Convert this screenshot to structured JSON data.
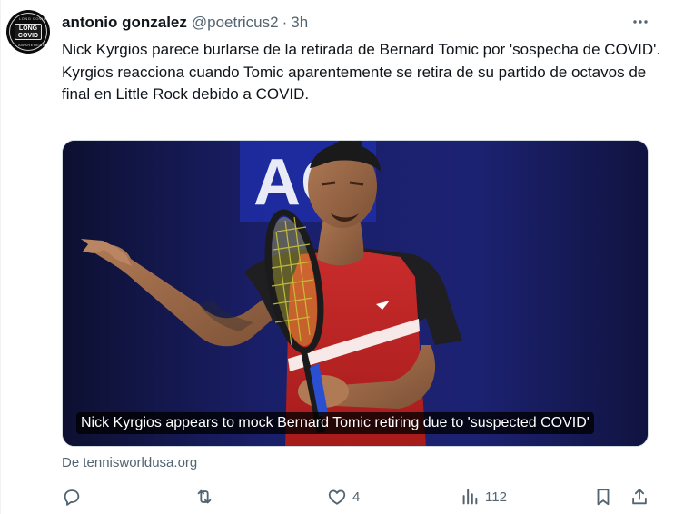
{
  "tweet": {
    "avatar_text": "LONG COVID",
    "avatar_arc_top": "LONG COVID",
    "avatar_arc_bottom": "AWARENESS",
    "display_name": "antonio gonzalez",
    "handle": "@poetricus2",
    "separator": "·",
    "time": "3h",
    "text_lines": [
      "Nick Kyrgios parece burlarse de la retirada de Bernard Tomic por 'sospecha de COVID'.",
      "Kyrgios reacciona cuando Tomic aparentemente se retira de su partido de octavos de final en Little Rock debido a COVID."
    ],
    "media": {
      "caption": "Nick Kyrgios appears to mock Bernard Tomic retiring due to 'suspected COVID'",
      "background_logo": "AO"
    },
    "source": "De tennisworldusa.org",
    "actions": {
      "reply_count": "",
      "retweet_count": "",
      "like_count": "4",
      "views_count": "112"
    }
  },
  "colors": {
    "text_primary": "#0f1419",
    "text_secondary": "#536471",
    "border": "#cfd9de",
    "media_bg": "#16194d"
  },
  "icons": [
    "more-icon",
    "reply-icon",
    "retweet-icon",
    "like-icon",
    "views-icon",
    "bookmark-icon",
    "share-icon"
  ]
}
